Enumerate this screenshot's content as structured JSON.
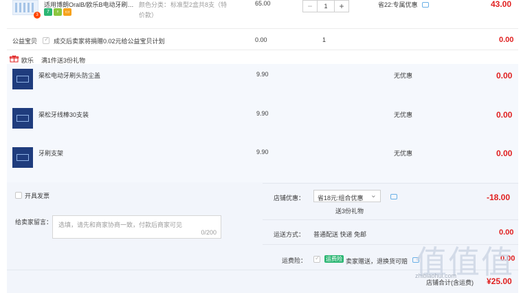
{
  "main_item": {
    "title": "适用博朗OralB/欧乐B电动牙刷…",
    "attr_label": "颜色分类：",
    "attr_value_1": "标准型2盒共8支（特",
    "attr_value_2": "价款）",
    "price": "65.00",
    "quantity": "1",
    "minus": "−",
    "plus": "+",
    "saving": "省22:专属优惠",
    "subtotal": "43.00",
    "badge_count": "3",
    "service_icons": [
      "7",
      "♀",
      "▭"
    ]
  },
  "charity": {
    "label": "公益宝贝",
    "text": "成交后卖家将捐赠0.02元给公益宝贝计划",
    "price": "0.00",
    "quantity": "1",
    "subtotal": "0.00"
  },
  "gift_header": {
    "shop": "欧乐",
    "promo": "满1件送3份礼物"
  },
  "gifts": [
    {
      "name": "渠松电动牙刷头防尘盖",
      "price": "9.90",
      "discount": "无优惠",
      "subtotal": "0.00",
      "thumb_text": "牙刷头防尘盖"
    },
    {
      "name": "渠松牙线棒30支装",
      "price": "9.90",
      "discount": "无优惠",
      "subtotal": "0.00",
      "thumb_text": "牙线"
    },
    {
      "name": "牙刷支架",
      "price": "9.90",
      "discount": "无优惠",
      "subtotal": "0.00",
      "thumb_text": "电动牙刷支架"
    }
  ],
  "invoice": {
    "label": "开具发票"
  },
  "message": {
    "label": "给卖家留言：",
    "placeholder": "选填，请先和商家协商一致，付款后商家可见",
    "counter": "0/200"
  },
  "shop_discount": {
    "label": "店铺优惠：",
    "selected": "省18元:组合优惠",
    "caret": "⌄",
    "gift_note": "送3份礼物",
    "amount": "-18.00"
  },
  "shipping": {
    "label": "运送方式：",
    "text": "普通配送 快递 免邮",
    "amount": "0.00"
  },
  "insurance": {
    "label": "运费险：",
    "badge": "运费险",
    "text": "卖家赠送，退换货可赔",
    "amount": "0.00"
  },
  "total": {
    "label": "店铺合计(含运费)",
    "amount": "¥25.00"
  },
  "watermark": {
    "big": "值值值",
    "small": "zhibiaohui.com"
  }
}
